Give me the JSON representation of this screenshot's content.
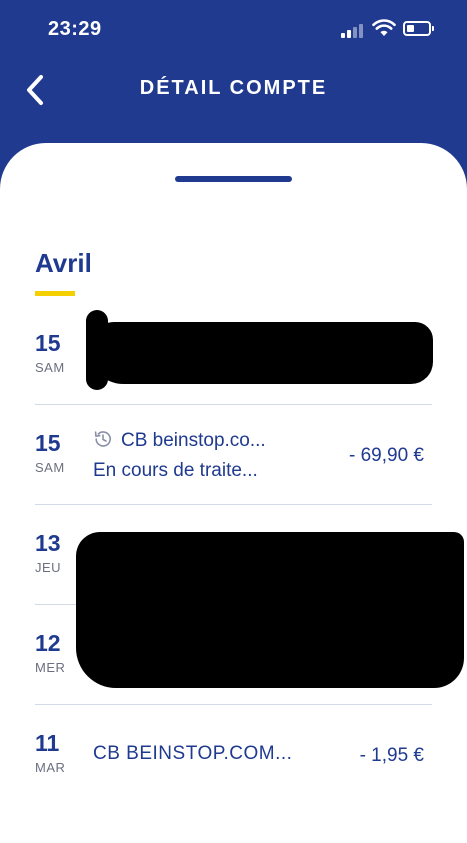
{
  "status_bar": {
    "time": "23:29"
  },
  "header": {
    "title": "DÉTAIL COMPTE",
    "back_icon": "chevron-left-icon"
  },
  "month": "Avril",
  "transactions": [
    {
      "day": "15",
      "weekday": "SAM",
      "label": "",
      "status": "",
      "amount": "",
      "redacted": true
    },
    {
      "day": "15",
      "weekday": "SAM",
      "label": "CB beinstop.co...",
      "status": "En cours de traite...",
      "amount": "- 69,90 €",
      "pending_icon": "history-clock-icon"
    },
    {
      "day": "13",
      "weekday": "JEU",
      "label": "",
      "status": "",
      "amount": "",
      "redacted": true
    },
    {
      "day": "12",
      "weekday": "MER",
      "label": "",
      "status": "",
      "amount": "",
      "redacted": true
    },
    {
      "day": "11",
      "weekday": "MAR",
      "label": "CB  BEINSTOP.COM...",
      "status": "",
      "amount": "- 1,95 €"
    }
  ],
  "colors": {
    "primary": "#1f3a8f",
    "accent": "#f5d000",
    "divider": "#d3d9e8"
  }
}
